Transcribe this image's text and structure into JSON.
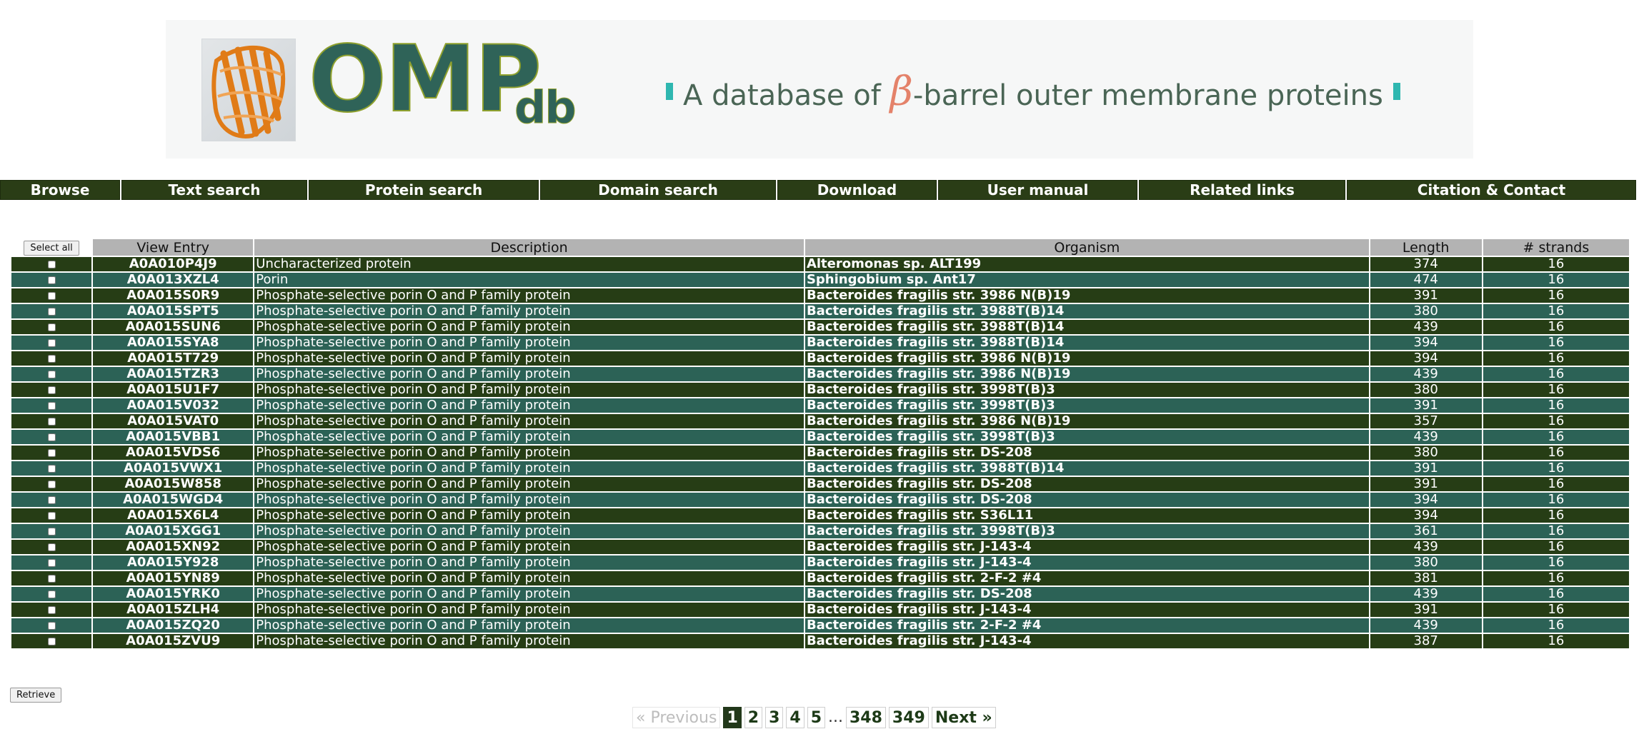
{
  "banner": {
    "logo_main": "OMP",
    "logo_sub": "db",
    "tagline_before": "A database of ",
    "tagline_beta": "β",
    "tagline_after": "-barrel outer membrane proteins"
  },
  "nav": [
    {
      "label": "Browse",
      "width": 168
    },
    {
      "label": "Text search",
      "width": 260
    },
    {
      "label": "Protein search",
      "width": 322
    },
    {
      "label": "Domain search",
      "width": 330
    },
    {
      "label": "Download",
      "width": 223
    },
    {
      "label": "User manual",
      "width": 279
    },
    {
      "label": "Related links",
      "width": 289
    },
    {
      "label": "Citation & Contact",
      "width": 405
    }
  ],
  "table": {
    "select_all_label": "Select all",
    "headers": [
      "View Entry",
      "Description",
      "Organism",
      "Length",
      "# strands"
    ],
    "rows": [
      [
        "A0A010P4J9",
        "Uncharacterized protein",
        "Alteromonas sp. ALT199",
        "374",
        "16"
      ],
      [
        "A0A013XZL4",
        "Porin",
        "Sphingobium sp. Ant17",
        "474",
        "16"
      ],
      [
        "A0A015S0R9",
        "Phosphate-selective porin O and P family protein",
        "Bacteroides fragilis str. 3986 N(B)19",
        "391",
        "16"
      ],
      [
        "A0A015SPT5",
        "Phosphate-selective porin O and P family protein",
        "Bacteroides fragilis str. 3988T(B)14",
        "380",
        "16"
      ],
      [
        "A0A015SUN6",
        "Phosphate-selective porin O and P family protein",
        "Bacteroides fragilis str. 3988T(B)14",
        "439",
        "16"
      ],
      [
        "A0A015SYA8",
        "Phosphate-selective porin O and P family protein",
        "Bacteroides fragilis str. 3988T(B)14",
        "394",
        "16"
      ],
      [
        "A0A015T729",
        "Phosphate-selective porin O and P family protein",
        "Bacteroides fragilis str. 3986 N(B)19",
        "394",
        "16"
      ],
      [
        "A0A015TZR3",
        "Phosphate-selective porin O and P family protein",
        "Bacteroides fragilis str. 3986 N(B)19",
        "439",
        "16"
      ],
      [
        "A0A015U1F7",
        "Phosphate-selective porin O and P family protein",
        "Bacteroides fragilis str. 3998T(B)3",
        "380",
        "16"
      ],
      [
        "A0A015V032",
        "Phosphate-selective porin O and P family protein",
        "Bacteroides fragilis str. 3998T(B)3",
        "391",
        "16"
      ],
      [
        "A0A015VAT0",
        "Phosphate-selective porin O and P family protein",
        "Bacteroides fragilis str. 3986 N(B)19",
        "357",
        "16"
      ],
      [
        "A0A015VBB1",
        "Phosphate-selective porin O and P family protein",
        "Bacteroides fragilis str. 3998T(B)3",
        "439",
        "16"
      ],
      [
        "A0A015VDS6",
        "Phosphate-selective porin O and P family protein",
        "Bacteroides fragilis str. DS-208",
        "380",
        "16"
      ],
      [
        "A0A015VWX1",
        "Phosphate-selective porin O and P family protein",
        "Bacteroides fragilis str. 3988T(B)14",
        "391",
        "16"
      ],
      [
        "A0A015W858",
        "Phosphate-selective porin O and P family protein",
        "Bacteroides fragilis str. DS-208",
        "391",
        "16"
      ],
      [
        "A0A015WGD4",
        "Phosphate-selective porin O and P family protein",
        "Bacteroides fragilis str. DS-208",
        "394",
        "16"
      ],
      [
        "A0A015X6L4",
        "Phosphate-selective porin O and P family protein",
        "Bacteroides fragilis str. S36L11",
        "394",
        "16"
      ],
      [
        "A0A015XGG1",
        "Phosphate-selective porin O and P family protein",
        "Bacteroides fragilis str. 3998T(B)3",
        "361",
        "16"
      ],
      [
        "A0A015XN92",
        "Phosphate-selective porin O and P family protein",
        "Bacteroides fragilis str. J-143-4",
        "439",
        "16"
      ],
      [
        "A0A015Y928",
        "Phosphate-selective porin O and P family protein",
        "Bacteroides fragilis str. J-143-4",
        "380",
        "16"
      ],
      [
        "A0A015YN89",
        "Phosphate-selective porin O and P family protein",
        "Bacteroides fragilis str. 2-F-2 #4",
        "381",
        "16"
      ],
      [
        "A0A015YRK0",
        "Phosphate-selective porin O and P family protein",
        "Bacteroides fragilis str. DS-208",
        "439",
        "16"
      ],
      [
        "A0A015ZLH4",
        "Phosphate-selective porin O and P family protein",
        "Bacteroides fragilis str. J-143-4",
        "391",
        "16"
      ],
      [
        "A0A015ZQ20",
        "Phosphate-selective porin O and P family protein",
        "Bacteroides fragilis str. 2-F-2 #4",
        "439",
        "16"
      ],
      [
        "A0A015ZVU9",
        "Phosphate-selective porin O and P family protein",
        "Bacteroides fragilis str. J-143-4",
        "387",
        "16"
      ]
    ]
  },
  "retrieve_label": "Retrieve",
  "pager": {
    "prev": "« Previous",
    "pages": [
      "1",
      "2",
      "3",
      "4",
      "5"
    ],
    "ellipsis": "...",
    "last_pages": [
      "348",
      "349"
    ],
    "next": "Next »",
    "current": "1"
  },
  "colors": {
    "nav_bg": "#2a3d16",
    "row_dark": "#263d15",
    "row_teal": "#2c6256",
    "header_grey": "#b3b3b3",
    "accent_orange": "#e4826a"
  }
}
